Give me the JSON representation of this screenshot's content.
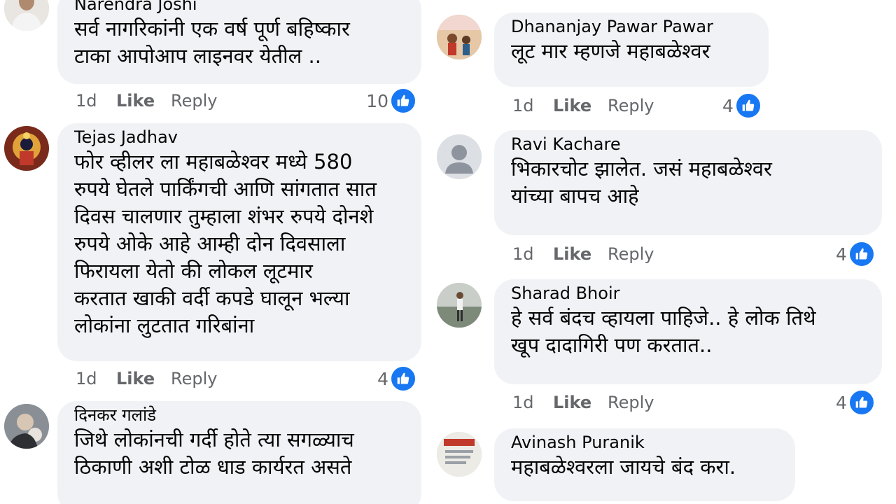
{
  "colors": {
    "bubble_bg": "#f0f2f5",
    "text": "#050505",
    "meta_text": "#65676b",
    "like_blue": "#1877f2"
  },
  "comments_left": [
    {
      "author": "Narendra Joshi",
      "text": "सर्व नागरिकांनी एक वर्ष पूर्ण बहिष्कार\nटाका आपोआप लाइनवर येतील ..",
      "time": "1d",
      "like_label": "Like",
      "reply_label": "Reply",
      "reaction_count": "10",
      "reaction_icon": "thumbs-up-icon"
    },
    {
      "author": "Tejas Jadhav",
      "text": "फोर व्हीलर ला महाबळेश्वर मध्ये 580\nरुपये घेतले पार्किंगची आणि सांगतात सात\nदिवस चालणार तुम्हाला शंभर रुपये दोनशे\nरुपये ओके आहे आम्ही दोन दिवसाला\nफिरायला येतो की लोकल लूटमार\nकरतात खाकी वर्दी कपडे घालून भल्या\nलोकांना लुटतात गरिबांना",
      "time": "1d",
      "like_label": "Like",
      "reply_label": "Reply",
      "reaction_count": "4",
      "reaction_icon": "thumbs-up-icon"
    },
    {
      "author": "दिनकर गलांडे",
      "text": "जिथे लोकांनची गर्दी होते त्या सगळ्याच\nठिकाणी अशी टोळ धाड कार्यरत असते"
    }
  ],
  "comments_right": [
    {
      "author": "Dhananjay Pawar Pawar",
      "text": "लूट मार म्हणजे महाबळेश्वर",
      "time": "1d",
      "like_label": "Like",
      "reply_label": "Reply",
      "reaction_count": "4",
      "reaction_icon": "thumbs-up-icon"
    },
    {
      "author": "Ravi Kachare",
      "text": "भिकारचोट झालेत. जसं महाबळेश्वर\nयांच्या बापच आहे",
      "time": "1d",
      "like_label": "Like",
      "reply_label": "Reply",
      "reaction_count": "4",
      "reaction_icon": "thumbs-up-icon"
    },
    {
      "author": "Sharad Bhoir",
      "text": "हे सर्व बंदच व्हायला पाहिजे.. हे लोक तिथे\nखूप दादागिरी पण करतात..",
      "time": "1d",
      "like_label": "Like",
      "reply_label": "Reply",
      "reaction_count": "4",
      "reaction_icon": "thumbs-up-icon"
    },
    {
      "author": "Avinash Puranik",
      "text": "महाबळेश्वरला जायचे बंद करा."
    }
  ]
}
